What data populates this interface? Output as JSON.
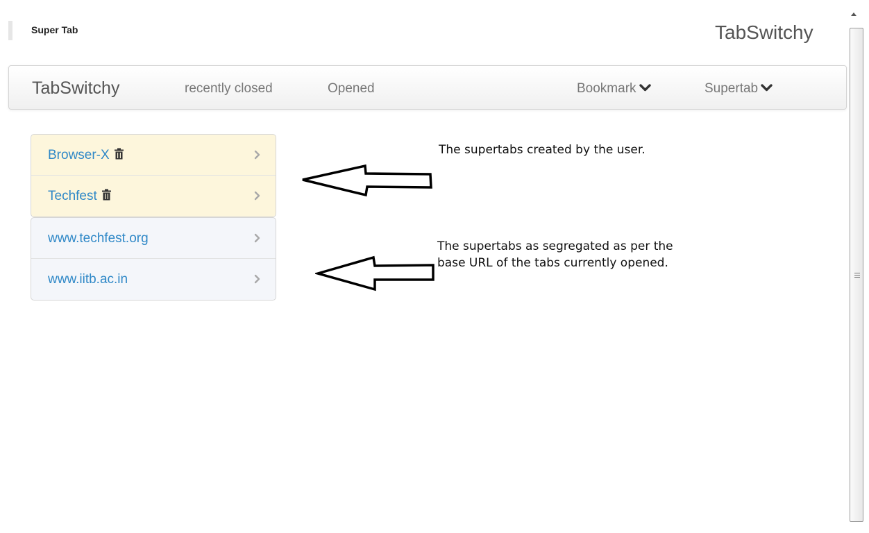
{
  "header": {
    "title": "Super Tab",
    "brand": "TabSwitchy"
  },
  "navbar": {
    "brand": "TabSwitchy",
    "links": [
      {
        "label": "recently closed"
      },
      {
        "label": "Opened"
      },
      {
        "label": "Bookmark",
        "icon": "chevron-down-icon"
      },
      {
        "label": "Supertab",
        "icon": "chevron-down-icon"
      }
    ]
  },
  "supertabs": [
    {
      "label": "Browser-X",
      "icon": "trash-icon"
    },
    {
      "label": "Techfest",
      "icon": "trash-icon"
    }
  ],
  "url_groups": [
    {
      "label": "www.techfest.org"
    },
    {
      "label": "www.iitb.ac.in"
    }
  ],
  "annotations": {
    "supertabs_note": "The supertabs created by the user.",
    "urls_note_line1": "The supertabs as segregated as per the",
    "urls_note_line2": "base URL of the tabs currently opened."
  },
  "colors": {
    "link": "#2f88c7",
    "supertab_bg": "#fdf6dc",
    "url_bg": "#f4f6fa"
  }
}
